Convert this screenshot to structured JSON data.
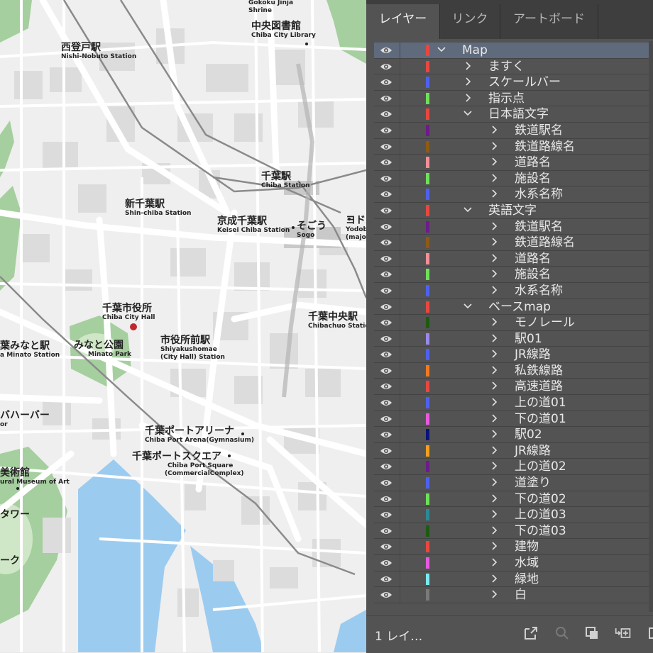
{
  "tabs": [
    {
      "label": "レイヤー",
      "active": true
    },
    {
      "label": "リンク",
      "active": false
    },
    {
      "label": "アートボード",
      "active": false
    }
  ],
  "layers": [
    {
      "name": "Map",
      "color": "#e8473f",
      "depth": 0,
      "expanded": true,
      "selected": true
    },
    {
      "name": "ますく",
      "color": "#e8473f",
      "depth": 1,
      "expanded": false
    },
    {
      "name": "スケールバー",
      "color": "#4d61f0",
      "depth": 1,
      "expanded": false
    },
    {
      "name": "指示点",
      "color": "#6fe05a",
      "depth": 1,
      "expanded": false
    },
    {
      "name": "日本語文字",
      "color": "#e8473f",
      "depth": 1,
      "expanded": true
    },
    {
      "name": "鉄道駅名",
      "color": "#6d1c8a",
      "depth": 2,
      "expanded": false
    },
    {
      "name": "鉄道路線名",
      "color": "#8e5a14",
      "depth": 2,
      "expanded": false
    },
    {
      "name": "道路名",
      "color": "#f0909a",
      "depth": 2,
      "expanded": false
    },
    {
      "name": "施設名",
      "color": "#6fe05a",
      "depth": 2,
      "expanded": false
    },
    {
      "name": "水系名称",
      "color": "#4d61f0",
      "depth": 2,
      "expanded": false
    },
    {
      "name": "英語文字",
      "color": "#e8473f",
      "depth": 1,
      "expanded": true
    },
    {
      "name": "鉄道駅名",
      "color": "#6d1c8a",
      "depth": 2,
      "expanded": false
    },
    {
      "name": "鉄道路線名",
      "color": "#8e5a14",
      "depth": 2,
      "expanded": false
    },
    {
      "name": "道路名",
      "color": "#f0909a",
      "depth": 2,
      "expanded": false
    },
    {
      "name": "施設名",
      "color": "#6fe05a",
      "depth": 2,
      "expanded": false
    },
    {
      "name": "水系名称",
      "color": "#4d61f0",
      "depth": 2,
      "expanded": false
    },
    {
      "name": "ベースmap",
      "color": "#e8473f",
      "depth": 1,
      "expanded": true
    },
    {
      "name": "モノレール",
      "color": "#1e5a12",
      "depth": 2,
      "expanded": false
    },
    {
      "name": "駅01",
      "color": "#9a8ae6",
      "depth": 2,
      "expanded": false
    },
    {
      "name": "JR線路",
      "color": "#4d61f0",
      "depth": 2,
      "expanded": false
    },
    {
      "name": "私鉄線路",
      "color": "#f07a22",
      "depth": 2,
      "expanded": false
    },
    {
      "name": "高速道路",
      "color": "#e8473f",
      "depth": 2,
      "expanded": false
    },
    {
      "name": "上の道01",
      "color": "#4d61f0",
      "depth": 2,
      "expanded": false
    },
    {
      "name": "下の道01",
      "color": "#e65ae0",
      "depth": 2,
      "expanded": false
    },
    {
      "name": "駅02",
      "color": "#0a1478",
      "depth": 2,
      "expanded": false
    },
    {
      "name": "JR線路",
      "color": "#f0a020",
      "depth": 2,
      "expanded": false
    },
    {
      "name": "上の道02",
      "color": "#6d1c8a",
      "depth": 2,
      "expanded": false
    },
    {
      "name": "道塗り",
      "color": "#4d61f0",
      "depth": 2,
      "expanded": false
    },
    {
      "name": "下の道02",
      "color": "#6fe05a",
      "depth": 2,
      "expanded": false
    },
    {
      "name": "上の道03",
      "color": "#2a8a96",
      "depth": 2,
      "expanded": false
    },
    {
      "name": "下の道03",
      "color": "#1e5a12",
      "depth": 2,
      "expanded": false
    },
    {
      "name": "建物",
      "color": "#e8473f",
      "depth": 2,
      "expanded": false
    },
    {
      "name": "水域",
      "color": "#e65ae0",
      "depth": 2,
      "expanded": false
    },
    {
      "name": "緑地",
      "color": "#7ee8f0",
      "depth": 2,
      "expanded": false
    },
    {
      "name": "白",
      "color": "#7a7a7a",
      "depth": 2,
      "expanded": false
    }
  ],
  "footer": {
    "layer_count": "1 レイ…",
    "icons": [
      "export-icon",
      "search-icon",
      "clip-mask-icon",
      "new-sublayer-icon",
      "new-layer-icon"
    ]
  },
  "map": {
    "labels": [
      {
        "jp": "Gokoku Jinja",
        "en": "Shrine"
      },
      {
        "jp": "中央図書館",
        "en": "Chiba City Library"
      },
      {
        "jp": "西登戸駅",
        "en": "Nishi-Nobuto Station"
      },
      {
        "jp": "千葉駅",
        "en": "Chiba Station"
      },
      {
        "jp": "新千葉駅",
        "en": "Shin-chiba Station"
      },
      {
        "jp": "京成千葉駅",
        "en": "Keisei Chiba Station"
      },
      {
        "jp": "そごう",
        "en": "Sogo"
      },
      {
        "jp": "ヨドバ",
        "en": "Yodoba"
      },
      {
        "jp": "",
        "en": "(major"
      },
      {
        "jp": "千葉市役所",
        "en": "Chiba City Hall"
      },
      {
        "jp": "千葉中央駅",
        "en": "Chibachuo Station"
      },
      {
        "jp": "葉みなと駅",
        "en": "a Minato Station"
      },
      {
        "jp": "みなと公園",
        "en": "Minato Park"
      },
      {
        "jp": "市役所前駅",
        "en": "Shiyakushomae"
      },
      {
        "jp": "",
        "en": "(City Hall) Station"
      },
      {
        "jp": "バハーバー",
        "en": "or"
      },
      {
        "jp": "千葉ポートアリーナ",
        "en": "Chiba Port Arena(Gymnasium)"
      },
      {
        "jp": "千葉ポートスクエア",
        "en": "Chiba Port Square"
      },
      {
        "jp": "",
        "en": "(CommercialComplex)"
      },
      {
        "jp": "美術館",
        "en": "ural Museum of Art"
      },
      {
        "jp": "タワー",
        "en": ""
      },
      {
        "jp": "ーク",
        "en": ""
      }
    ]
  }
}
